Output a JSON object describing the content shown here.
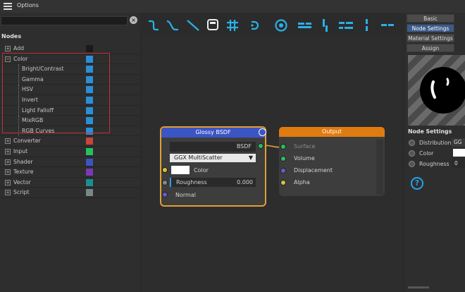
{
  "window": {
    "title": "Options"
  },
  "search": {
    "placeholder": ""
  },
  "nodes_header": "Nodes",
  "tree": [
    {
      "label": "Add",
      "expanded": false,
      "child": false,
      "color": "#1a1a1a"
    },
    {
      "label": "Color",
      "expanded": true,
      "child": false,
      "color": "#2a8fd6"
    },
    {
      "label": "Bright/Contrast",
      "child": true,
      "color": "#2a8fd6"
    },
    {
      "label": "Gamma",
      "child": true,
      "color": "#2a8fd6"
    },
    {
      "label": "HSV",
      "child": true,
      "color": "#2a8fd6"
    },
    {
      "label": "Invert",
      "child": true,
      "color": "#2a8fd6"
    },
    {
      "label": "Light Falloff",
      "child": true,
      "color": "#2a8fd6"
    },
    {
      "label": "MixRGB",
      "child": true,
      "color": "#2a8fd6"
    },
    {
      "label": "RGB Curves",
      "child": true,
      "color": "#2a8fd6"
    },
    {
      "label": "Converter",
      "expanded": false,
      "child": false,
      "color": "#c7453a"
    },
    {
      "label": "Input",
      "expanded": false,
      "child": false,
      "color": "#27c060"
    },
    {
      "label": "Shader",
      "expanded": false,
      "child": false,
      "color": "#3a55c2"
    },
    {
      "label": "Texture",
      "expanded": false,
      "child": false,
      "color": "#7a3ab8"
    },
    {
      "label": "Vector",
      "expanded": false,
      "child": false,
      "color": "#1a8f8f"
    },
    {
      "label": "Script",
      "expanded": false,
      "child": false,
      "color": "#778888"
    }
  ],
  "toolbar_icons": [
    "curve-step-icon",
    "curve-smooth-icon",
    "curve-linear-icon",
    "frame-icon",
    "grid-snap-icon",
    "reroute-icon",
    "refresh-icon",
    "align-left-icon",
    "align-top-icon",
    "align-center-icon",
    "align-vertical-icon",
    "align-horizontal-icon"
  ],
  "glossy_node": {
    "title": "Glossy BSDF",
    "output": "BSDF",
    "distribution": "GGX MultiScatter",
    "color_label": "Color",
    "roughness_label": "Roughness",
    "roughness_value": "0.000",
    "normal_label": "Normal"
  },
  "output_node": {
    "title": "Output",
    "inputs": [
      "Surface",
      "Volume",
      "Displacement",
      "Alpha"
    ]
  },
  "right_tabs": [
    "Basic",
    "Node Settings",
    "Material Settings",
    "Assign"
  ],
  "node_settings": {
    "header": "Node Settings",
    "distribution_label": "Distribution",
    "distribution_value": "GG",
    "color_label": "Color",
    "roughness_label": "Roughness",
    "roughness_value": "0"
  },
  "colors": {
    "glossy_header": "#3b55c4",
    "output_header": "#e07b10",
    "selection_outline": "#e0a030",
    "accent": "#2aa0e8"
  }
}
